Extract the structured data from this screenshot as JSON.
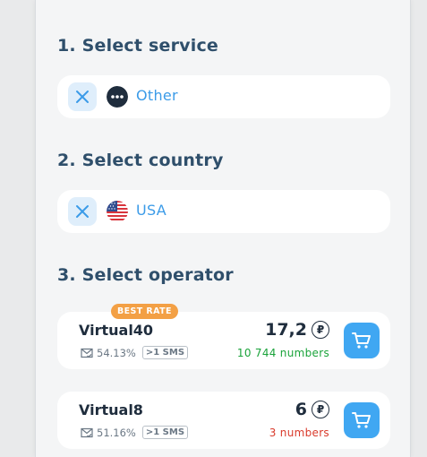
{
  "sections": {
    "service": {
      "title": "1. Select service",
      "selected": "Other",
      "icon": "more-dots-icon"
    },
    "country": {
      "title": "2. Select country",
      "selected": "USA",
      "icon": "usa-flag-icon"
    },
    "operator": {
      "title": "3. Select operator"
    }
  },
  "operators": [
    {
      "badge": "BEST RATE",
      "name": "Virtual40",
      "rate": "54.13%",
      "sms_tag": ">1 SMS",
      "price": "17,2",
      "currency_symbol": "₽",
      "numbers": "10 744 numbers",
      "numbers_color": "#1aa33a"
    },
    {
      "name": "Virtual8",
      "rate": "51.16%",
      "sms_tag": ">1 SMS",
      "price": "6",
      "currency_symbol": "₽",
      "numbers": "3 numbers",
      "numbers_color": "#d93a2b"
    }
  ],
  "colors": {
    "accent": "#3b9be8",
    "cart_button": "#40a7f2",
    "title": "#2f4f6b",
    "badge": "#f3a045"
  }
}
